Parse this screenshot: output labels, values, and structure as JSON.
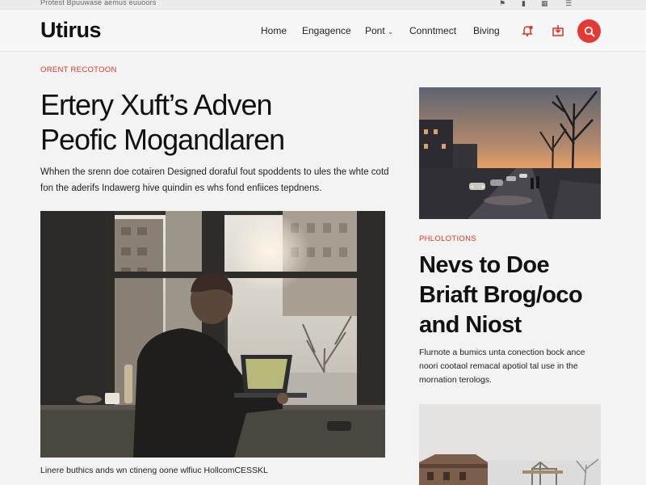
{
  "topbar": {
    "tagline": "Protest Bpuuwase aemus euuoors",
    "icons": [
      "flag-icon",
      "bookmark-icon",
      "grid-icon",
      "menu-icon"
    ]
  },
  "header": {
    "logo": "Utirus",
    "nav": [
      "Home",
      "Engagence",
      "Pont",
      "Conntmect",
      "Biving"
    ],
    "icons": [
      "bell-icon",
      "share-icon",
      "search-icon"
    ],
    "accent": "#e53935"
  },
  "hero": {
    "kicker": "ORENT RECOTOON",
    "title_line1": "Ertery Xuft’s Adven",
    "title_line2": "Peofic Mogandlaren",
    "desc_line1": "Whhen the srenn doe cotairen Designed doraful fout spoddents to ules the whte cotd",
    "desc_line2": "fon the aderifs Indawerg hive quindin es whs fond enfiices tepdnens."
  },
  "main_caption": "Linere buthics ands wn ctineng oone wlfiuc HollcomCESSKL",
  "sidebar": {
    "kicker": "PHLOLOTIONS",
    "title_line1": "Nevs to Doe",
    "title_line2": "Briaft Brog/oco",
    "title_line3": "and Niost",
    "desc_line1": "Flurnote a bumics unta conection bock ance",
    "desc_line2": "noori cootaol remacal apotiol tal use in the",
    "desc_line3": "mornation terologs."
  },
  "colors": {
    "accent": "#e53935",
    "kicker": "#e2352a",
    "text": "#111111"
  }
}
